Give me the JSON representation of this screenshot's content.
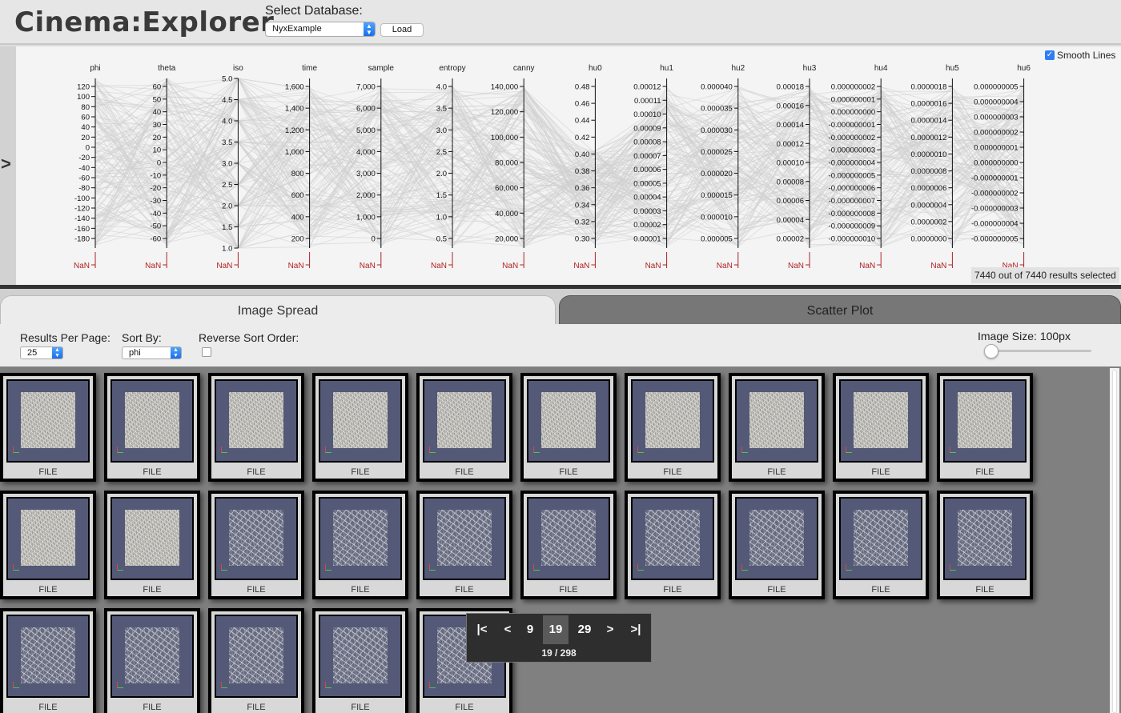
{
  "header": {
    "app_title": "Cinema:Explorer",
    "select_database_label": "Select Database:",
    "database_selected": "NyxExample",
    "load_label": "Load"
  },
  "pcoord": {
    "smooth_lines_label": "Smooth Lines",
    "smooth_lines_checked": true,
    "selection_count": "7440 out of 7440 results selected",
    "nan_label": "NaN",
    "axes": [
      {
        "name": "phi",
        "ticks": [
          "120",
          "100",
          "80",
          "60",
          "40",
          "20",
          "0",
          "-20",
          "-40",
          "-60",
          "-80",
          "-100",
          "-120",
          "-140",
          "-160",
          "-180"
        ]
      },
      {
        "name": "theta",
        "ticks": [
          "60",
          "50",
          "40",
          "30",
          "20",
          "10",
          "0",
          "-10",
          "-20",
          "-30",
          "-40",
          "-50",
          "-60"
        ]
      },
      {
        "name": "iso",
        "ticks": [
          "5.0",
          "4.5",
          "4.0",
          "3.5",
          "3.0",
          "2.5",
          "2.0",
          "1.5",
          "1.0"
        ]
      },
      {
        "name": "time",
        "ticks": [
          "1,600",
          "1,400",
          "1,200",
          "1,000",
          "800",
          "600",
          "400",
          "200"
        ]
      },
      {
        "name": "sample",
        "ticks": [
          "7,000",
          "6,000",
          "5,000",
          "4,000",
          "3,000",
          "2,000",
          "1,000",
          "0"
        ]
      },
      {
        "name": "entropy",
        "ticks": [
          "4.0",
          "3.5",
          "3.0",
          "2.5",
          "2.0",
          "1.5",
          "1.0",
          "0.5"
        ]
      },
      {
        "name": "canny",
        "ticks": [
          "140,000",
          "120,000",
          "100,000",
          "80,000",
          "60,000",
          "40,000",
          "20,000"
        ]
      },
      {
        "name": "hu0",
        "ticks": [
          "0.48",
          "0.46",
          "0.44",
          "0.42",
          "0.40",
          "0.38",
          "0.36",
          "0.34",
          "0.32",
          "0.30"
        ]
      },
      {
        "name": "hu1",
        "ticks": [
          "0.00012",
          "0.00011",
          "0.00010",
          "0.00009",
          "0.00008",
          "0.00007",
          "0.00006",
          "0.00005",
          "0.00004",
          "0.00003",
          "0.00002",
          "0.00001"
        ]
      },
      {
        "name": "hu2",
        "ticks": [
          "0.000040",
          "0.000035",
          "0.000030",
          "0.000025",
          "0.000020",
          "0.000015",
          "0.000010",
          "0.000005"
        ]
      },
      {
        "name": "hu3",
        "ticks": [
          "0.00018",
          "0.00016",
          "0.00014",
          "0.00012",
          "0.00010",
          "0.00008",
          "0.00006",
          "0.00004",
          "0.00002"
        ]
      },
      {
        "name": "hu4",
        "ticks": [
          "0.000000002",
          "0.000000001",
          "0.000000000",
          "-0.000000001",
          "-0.000000002",
          "-0.000000003",
          "-0.000000004",
          "-0.000000005",
          "-0.000000006",
          "-0.000000007",
          "-0.000000008",
          "-0.000000009",
          "-0.000000010"
        ]
      },
      {
        "name": "hu5",
        "ticks": [
          "0.0000018",
          "0.0000016",
          "0.0000014",
          "0.0000012",
          "0.0000010",
          "0.0000008",
          "0.0000006",
          "0.0000004",
          "0.0000002",
          "0.0000000"
        ]
      },
      {
        "name": "hu6",
        "ticks": [
          "0.000000005",
          "0.000000004",
          "0.000000003",
          "0.000000002",
          "0.000000001",
          "0.000000000",
          "-0.000000001",
          "-0.000000002",
          "-0.000000003",
          "-0.000000004",
          "-0.000000005"
        ]
      }
    ]
  },
  "tabs": [
    {
      "label": "Image Spread",
      "active": true
    },
    {
      "label": "Scatter Plot",
      "active": false
    }
  ],
  "controls": {
    "results_per_page_label": "Results Per Page:",
    "results_per_page_value": "25",
    "sort_by_label": "Sort By:",
    "sort_by_value": "phi",
    "reverse_sort_label": "Reverse Sort Order:",
    "reverse_sort_checked": false,
    "image_size_label": "Image Size: 100px"
  },
  "grid": {
    "file_label": "FILE",
    "card_count": 25
  },
  "pagination": {
    "first": "|<",
    "prev": "<",
    "pages": [
      "9",
      "19",
      "29"
    ],
    "current_page": "19",
    "next": ">",
    "last": ">|",
    "status": "19 / 298"
  },
  "colors": {
    "nan": "#b22222",
    "lines": "#cfcfcf",
    "accent": "#2f7cf6"
  }
}
